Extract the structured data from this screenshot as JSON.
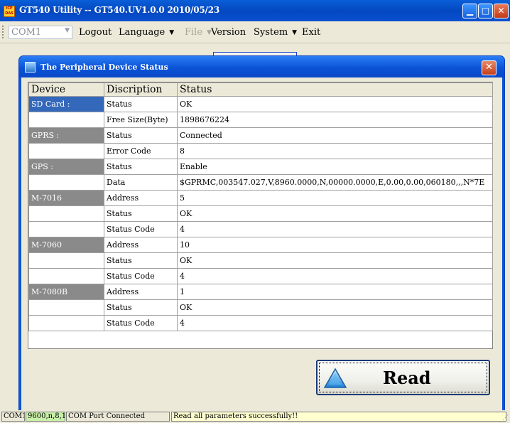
{
  "app": {
    "title": "GT540 Utility -- GT540.UV1.0.0 2010/05/23",
    "icon_text": "ICP DAS",
    "min_glyph": "▁",
    "max_glyph": "□",
    "close_glyph": "✕"
  },
  "menubar": {
    "com_port": "COM1",
    "items": [
      {
        "label": "Logout",
        "has_submenu": false,
        "enabled": true
      },
      {
        "label": "Language",
        "has_submenu": true,
        "enabled": true
      },
      {
        "label": "File",
        "has_submenu": true,
        "enabled": false
      },
      {
        "label": "Version",
        "has_submenu": false,
        "enabled": true
      },
      {
        "label": "System",
        "has_submenu": true,
        "enabled": true
      },
      {
        "label": "Exit",
        "has_submenu": false,
        "enabled": true
      }
    ]
  },
  "dialog": {
    "title": "The Peripheral Device Status",
    "close_glyph": "✕",
    "columns": [
      "Device",
      "Discription",
      "Status"
    ],
    "rows": [
      {
        "device": "SD Card :",
        "device_style": "blue",
        "desc": "Status",
        "status": "OK"
      },
      {
        "device": "",
        "device_style": "",
        "desc": "Free Size(Byte)",
        "status": "1898676224"
      },
      {
        "device": "GPRS :",
        "device_style": "gray",
        "desc": "Status",
        "status": "Connected"
      },
      {
        "device": "",
        "device_style": "",
        "desc": "Error Code",
        "status": "8"
      },
      {
        "device": "GPS :",
        "device_style": "gray",
        "desc": "Status",
        "status": "Enable"
      },
      {
        "device": "",
        "device_style": "",
        "desc": "Data",
        "status": "$GPRMC,003547.027,V,8960.0000,N,00000.0000,E,0.00,0.00,060180,,,N*7E"
      },
      {
        "device": "M-7016",
        "device_style": "gray",
        "desc": "Address",
        "status": "5"
      },
      {
        "device": "",
        "device_style": "",
        "desc": "Status",
        "status": "OK"
      },
      {
        "device": "",
        "device_style": "",
        "desc": "Status Code",
        "status": "4"
      },
      {
        "device": "M-7060",
        "device_style": "gray",
        "desc": "Address",
        "status": "10"
      },
      {
        "device": "",
        "device_style": "",
        "desc": "Status",
        "status": "OK"
      },
      {
        "device": "",
        "device_style": "",
        "desc": "Status Code",
        "status": "4"
      },
      {
        "device": "M-7080B",
        "device_style": "gray",
        "desc": "Address",
        "status": "1"
      },
      {
        "device": "",
        "device_style": "",
        "desc": "Status",
        "status": "OK"
      },
      {
        "device": "",
        "device_style": "",
        "desc": "Status Code",
        "status": "4"
      }
    ],
    "read_button": {
      "label": "Read",
      "icon": "triangle-icon"
    }
  },
  "statusbar": {
    "panels": [
      {
        "text": "COM1",
        "bg": "#ece9d8"
      },
      {
        "text": "9600,n,8,1",
        "bg": "#c8f0a8"
      },
      {
        "text": "COM Port Connected",
        "bg": "#ece9d8"
      },
      {
        "text": "Read all parameters successfully!!",
        "bg": "#ffffd0"
      }
    ]
  },
  "colors": {
    "titlebar": "#0a4fcf",
    "device_blue": "#3468bb",
    "device_gray": "#8a8a8a",
    "window_bg": "#ece9d8"
  }
}
